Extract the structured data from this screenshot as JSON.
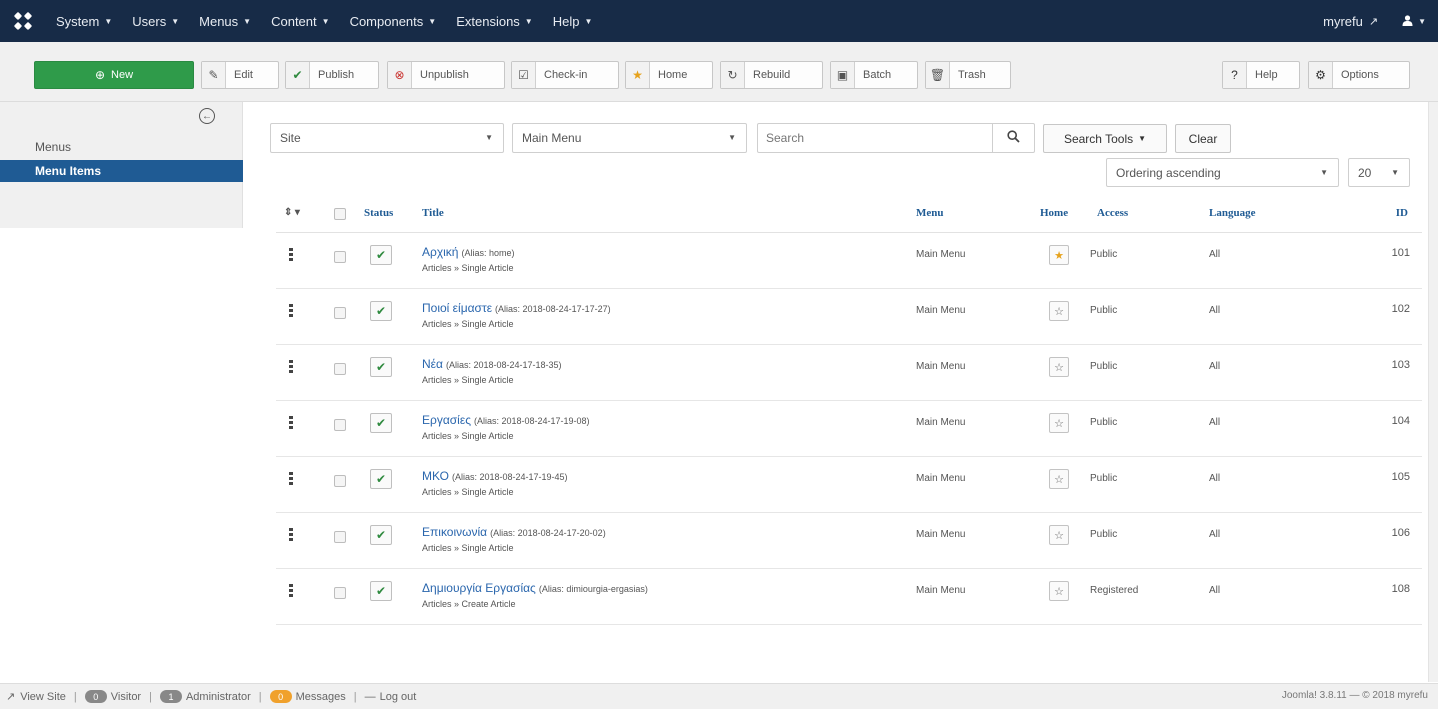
{
  "navbar": {
    "menus": [
      {
        "label": "System"
      },
      {
        "label": "Users"
      },
      {
        "label": "Menus"
      },
      {
        "label": "Content"
      },
      {
        "label": "Components"
      },
      {
        "label": "Extensions"
      },
      {
        "label": "Help"
      }
    ],
    "site_link": "myrefu",
    "bg_color": "#172b47"
  },
  "toolbar": {
    "new_label": "New",
    "buttons": [
      {
        "label": "Edit",
        "icon": "edit-icon"
      },
      {
        "label": "Publish",
        "icon": "check-icon"
      },
      {
        "label": "Unpublish",
        "icon": "unpublish-icon"
      },
      {
        "label": "Check-in",
        "icon": "checkin-icon"
      },
      {
        "label": "Home",
        "icon": "star-icon"
      },
      {
        "label": "Rebuild",
        "icon": "refresh-icon"
      },
      {
        "label": "Batch",
        "icon": "batch-icon"
      },
      {
        "label": "Trash",
        "icon": "trash-icon"
      }
    ],
    "help_label": "Help",
    "options_label": "Options"
  },
  "sidebar": {
    "items": [
      {
        "label": "Menus",
        "active": false
      },
      {
        "label": "Menu Items",
        "active": true
      }
    ]
  },
  "filters": {
    "client": "Site",
    "menu": "Main Menu",
    "search_placeholder": "Search",
    "search_tools_label": "Search Tools",
    "clear_label": "Clear",
    "ordering": "Ordering ascending",
    "limit": "20"
  },
  "table": {
    "headers": {
      "status": "Status",
      "title": "Title",
      "menu": "Menu",
      "home": "Home",
      "access": "Access",
      "language": "Language",
      "id": "ID"
    },
    "rows": [
      {
        "title": "Αρχική",
        "alias": "(Alias: home)",
        "type": "Articles » Single Article",
        "menu": "Main Menu",
        "home": true,
        "access": "Public",
        "language": "All",
        "id": "101"
      },
      {
        "title": "Ποιοί είμαστε",
        "alias": "(Alias: 2018-08-24-17-17-27)",
        "type": "Articles » Single Article",
        "menu": "Main Menu",
        "home": false,
        "access": "Public",
        "language": "All",
        "id": "102"
      },
      {
        "title": "Νέα",
        "alias": "(Alias: 2018-08-24-17-18-35)",
        "type": "Articles » Single Article",
        "menu": "Main Menu",
        "home": false,
        "access": "Public",
        "language": "All",
        "id": "103"
      },
      {
        "title": "Εργασίες",
        "alias": "(Alias: 2018-08-24-17-19-08)",
        "type": "Articles » Single Article",
        "menu": "Main Menu",
        "home": false,
        "access": "Public",
        "language": "All",
        "id": "104"
      },
      {
        "title": "ΜΚΟ",
        "alias": "(Alias: 2018-08-24-17-19-45)",
        "type": "Articles » Single Article",
        "menu": "Main Menu",
        "home": false,
        "access": "Public",
        "language": "All",
        "id": "105"
      },
      {
        "title": "Επικοινωνία",
        "alias": "(Alias: 2018-08-24-17-20-02)",
        "type": "Articles » Single Article",
        "menu": "Main Menu",
        "home": false,
        "access": "Public",
        "language": "All",
        "id": "106"
      },
      {
        "title": "Δημιουργία Εργασίας",
        "alias": "(Alias: dimiourgia-ergasias)",
        "type": "Articles » Create Article",
        "menu": "Main Menu",
        "home": false,
        "access": "Registered",
        "language": "All",
        "id": "108"
      }
    ]
  },
  "footer": {
    "view_site": "View Site",
    "visitor_count": "0",
    "visitor_label": "Visitor",
    "admin_count": "1",
    "admin_label": "Administrator",
    "messages_count": "0",
    "messages_label": "Messages",
    "logout_label": "Log out",
    "version": "Joomla! 3.8.11 — © 2018 myrefu"
  }
}
